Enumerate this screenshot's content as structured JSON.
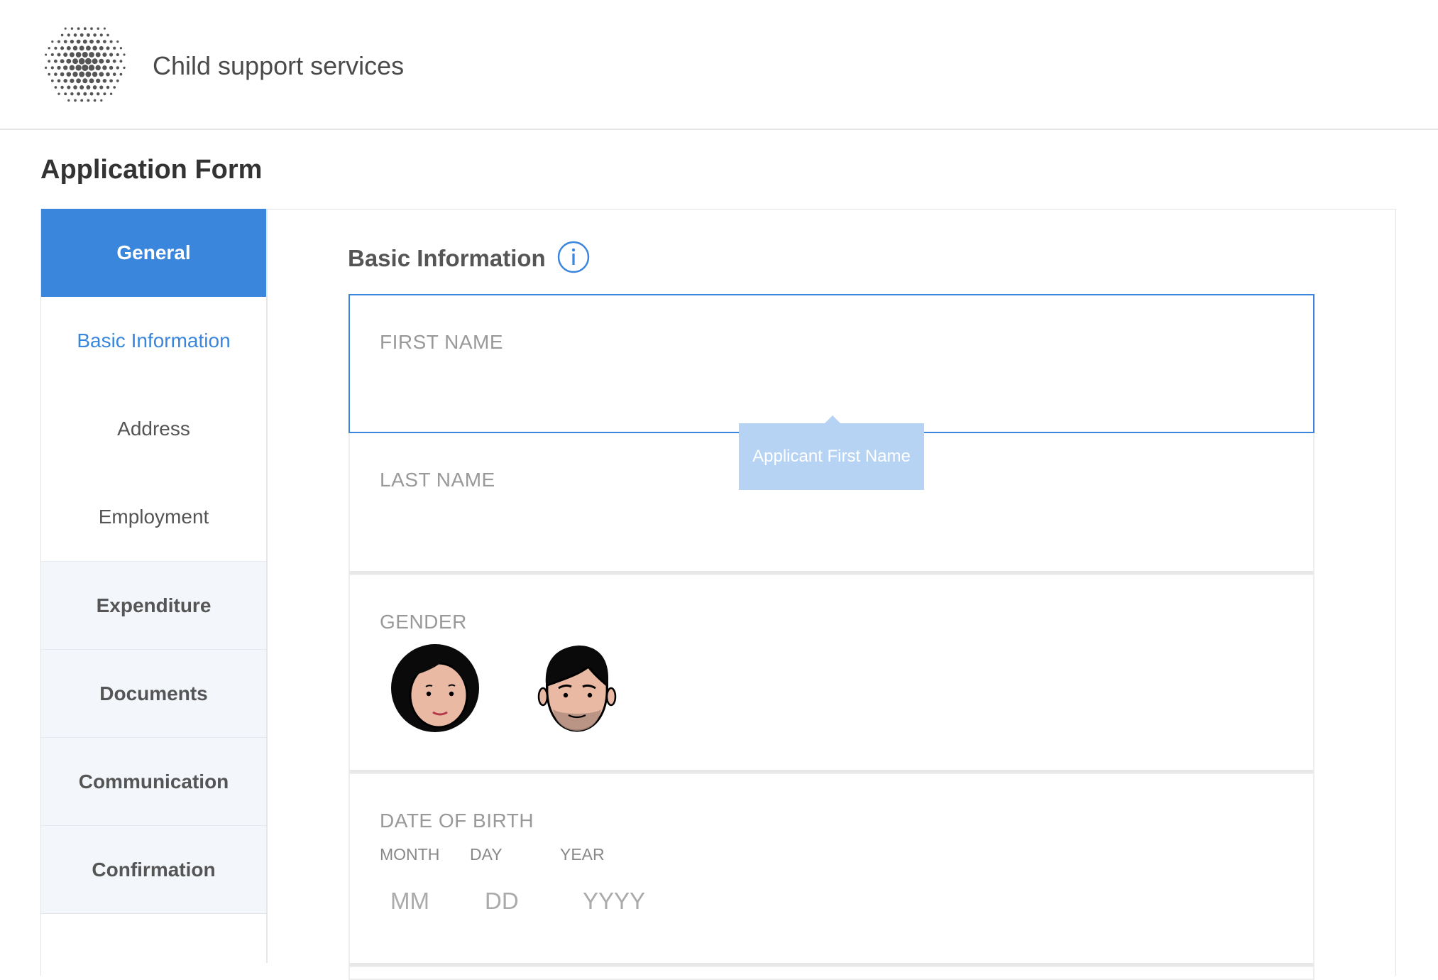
{
  "header": {
    "app_title": "Child support services"
  },
  "page": {
    "title": "Application Form"
  },
  "sidebar": {
    "items": [
      {
        "label": "General"
      },
      {
        "label": "Basic Information"
      },
      {
        "label": "Address"
      },
      {
        "label": "Employment"
      },
      {
        "label": "Expenditure"
      },
      {
        "label": "Documents"
      },
      {
        "label": "Communication"
      },
      {
        "label": "Confirmation"
      }
    ]
  },
  "main": {
    "section_heading": "Basic Information",
    "info_icon": "info-circle-icon",
    "first_name": {
      "label": "FIRST NAME",
      "value": ""
    },
    "last_name": {
      "label": "LAST NAME",
      "value": ""
    },
    "gender": {
      "label": "GENDER",
      "options": [
        "female-avatar-icon",
        "male-avatar-icon"
      ]
    },
    "dob": {
      "label": "DATE OF BIRTH",
      "month_label": "MONTH",
      "day_label": "DAY",
      "year_label": "YEAR",
      "month_placeholder": "MM",
      "day_placeholder": "DD",
      "year_placeholder": "YYYY"
    },
    "tooltip": "Applicant First Name"
  },
  "colors": {
    "accent": "#3a86dd",
    "tooltip_bg": "#b6d3f3",
    "nav_group_bg": "#f3f6fa"
  }
}
